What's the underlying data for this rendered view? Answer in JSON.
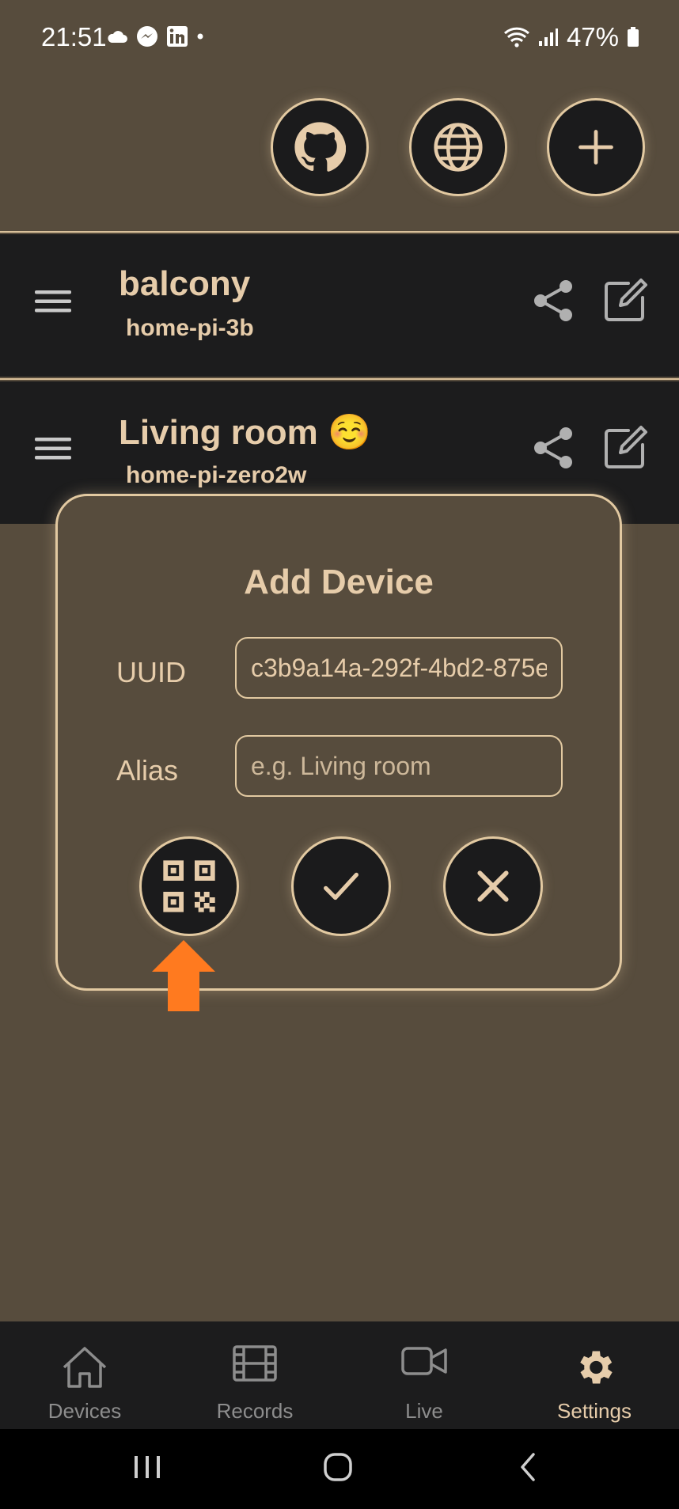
{
  "status_bar": {
    "time": "21:51",
    "battery": "47%"
  },
  "devices": [
    {
      "name": "balcony",
      "host": "home-pi-3b"
    },
    {
      "name": "Living room ☺️",
      "host": "home-pi-zero2w"
    }
  ],
  "dialog": {
    "title": "Add Device",
    "uuid_label": "UUID",
    "uuid_value": "c3b9a14a-292f-4bd2-875e",
    "alias_label": "Alias",
    "alias_placeholder": "e.g. Living room"
  },
  "bottom_nav": {
    "items": [
      {
        "label": "Devices",
        "icon": "home-icon"
      },
      {
        "label": "Records",
        "icon": "film-icon"
      },
      {
        "label": "Live",
        "icon": "video-icon"
      },
      {
        "label": "Settings",
        "icon": "gear-icon",
        "active": true
      }
    ]
  },
  "colors": {
    "background": "#574c3d",
    "surface": "#1c1c1d",
    "accent": "#e6ccaa",
    "annotation_arrow": "#ff7a1f"
  }
}
